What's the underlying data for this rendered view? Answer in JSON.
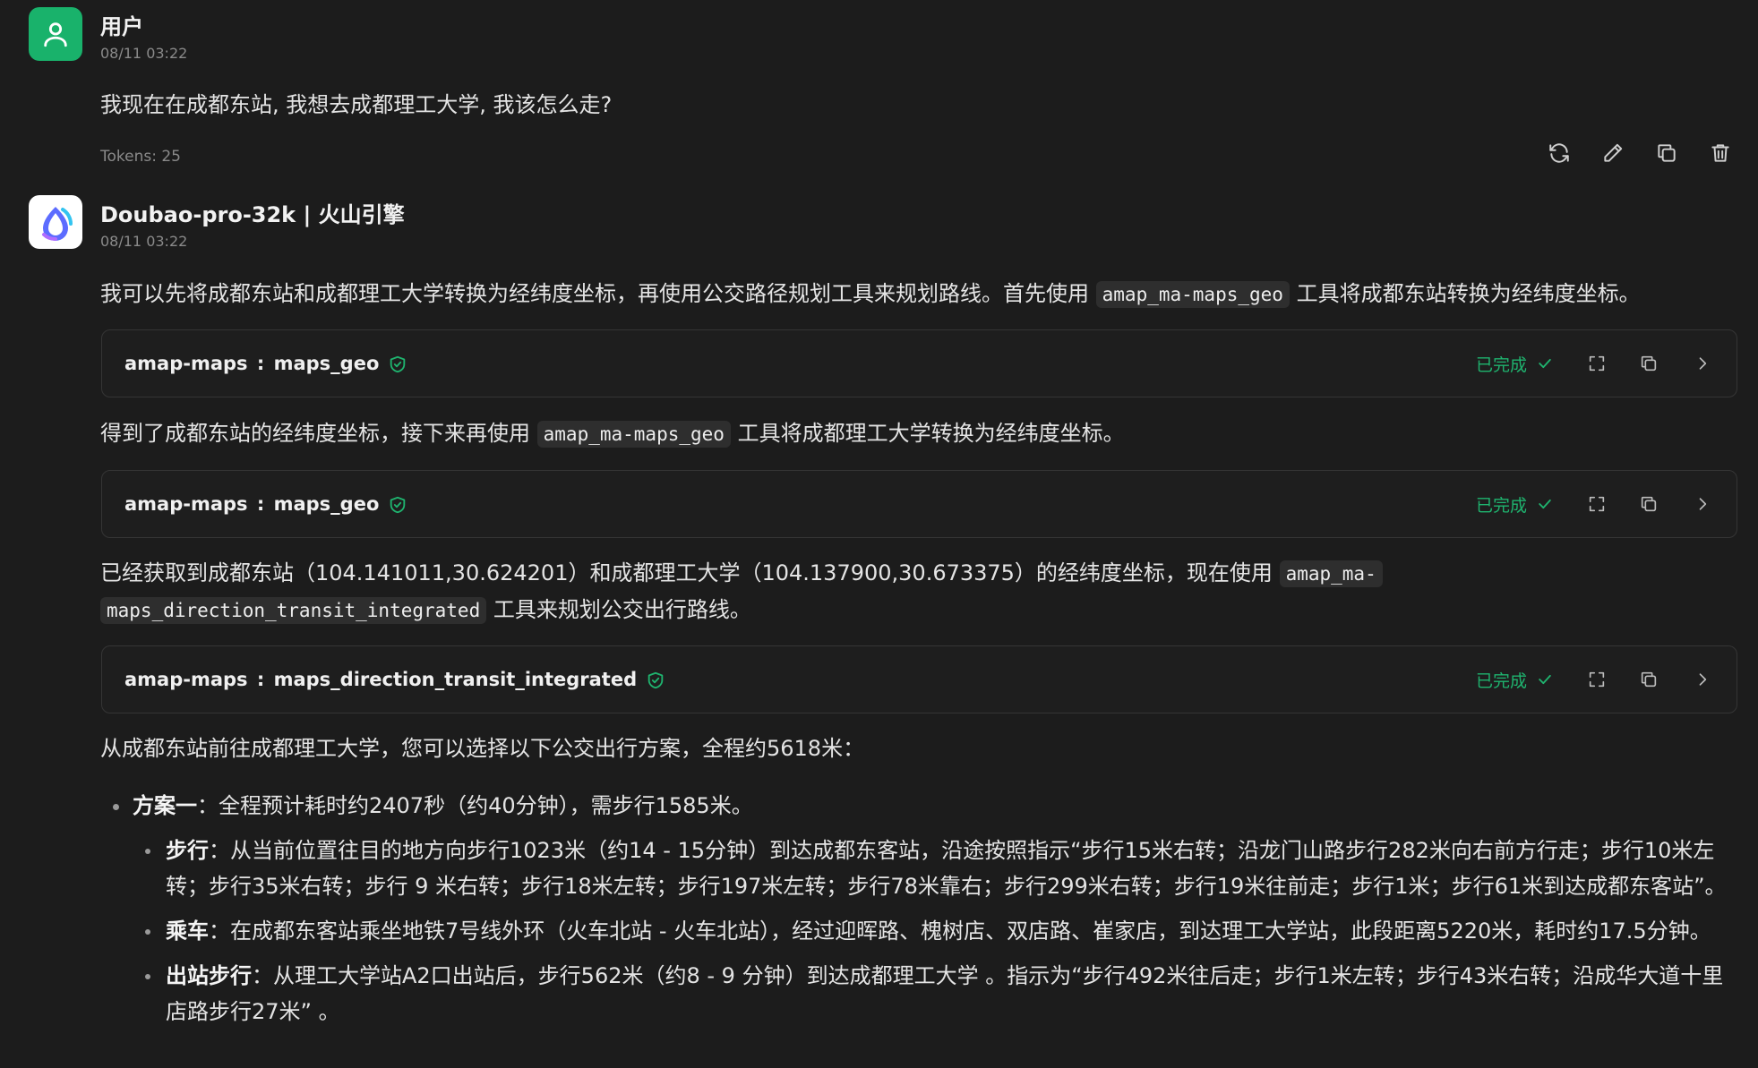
{
  "user_msg": {
    "name": "用户",
    "time": "08/11 03:22",
    "text": "我现在在成都东站, 我想去成都理工大学, 我该怎么走?",
    "tokens": "Tokens: 25"
  },
  "bot_msg": {
    "name": "Doubao-pro-32k | 火山引擎",
    "time": "08/11 03:22",
    "p1_before": "我可以先将成都东站和成都理工大学转换为经纬度坐标，再使用公交路径规划工具来规划路线。首先使用 ",
    "p1_code": "amap_ma-maps_geo",
    "p1_after": " 工具将成都东站转换为经纬度坐标。",
    "p2_before": "得到了成都东站的经纬度坐标，接下来再使用 ",
    "p2_code": "amap_ma-maps_geo",
    "p2_after": " 工具将成都理工大学转换为经纬度坐标。",
    "p3_before": "已经获取到成都东站（104.141011,30.624201）和成都理工大学（104.137900,30.673375）的经纬度坐标，现在使用 ",
    "p3_code_a": "amap_ma-",
    "p3_code_b": "maps_direction_transit_integrated",
    "p3_after": " 工具来规划公交出行路线。",
    "p4": "从成都东站前往成都理工大学，您可以选择以下公交出行方案，全程约5618米："
  },
  "tools": [
    {
      "server": "amap-maps",
      "sep": ":",
      "fn": "maps_geo",
      "status": "已完成"
    },
    {
      "server": "amap-maps",
      "sep": ":",
      "fn": "maps_geo",
      "status": "已完成"
    },
    {
      "server": "amap-maps",
      "sep": ":",
      "fn": "maps_direction_transit_integrated",
      "status": "已完成"
    }
  ],
  "plan": {
    "title": "方案一",
    "summary": "：全程预计耗时约2407秒（约40分钟），需步行1585米。",
    "steps": [
      {
        "label": "步行",
        "text": "：从当前位置往目的地方向步行1023米（约14 - 15分钟）到达成都东客站，沿途按照指示“步行15米右转；沿龙门山路步行282米向右前方行走；步行10米左转；步行35米右转；步行 9 米右转；步行18米左转；步行197米左转；步行78米靠右；步行299米右转；步行19米往前走；步行1米；步行61米到达成都东客站”。"
      },
      {
        "label": "乘车",
        "text": "：在成都东客站乘坐地铁7号线外环（火车北站 - 火车北站），经过迎晖路、槐树店、双店路、崔家店，到达理工大学站，此段距离5220米，耗时约17.5分钟。"
      },
      {
        "label": "出站步行",
        "text": "：从理工大学站A2口出站后，步行562米（约8 - 9 分钟）到达成都理工大学 。指示为“步行492米往后走；步行1米左转；步行43米右转；沿成华大道十里店路步行27米” 。"
      }
    ]
  },
  "icons": {
    "accent": "#19b26b",
    "status_color": "#1fb46f",
    "user_avatar": "user-icon",
    "bot_avatar": "doubao-logo-icon",
    "actions": [
      "refresh-icon",
      "edit-icon",
      "copy-icon",
      "delete-icon"
    ]
  }
}
